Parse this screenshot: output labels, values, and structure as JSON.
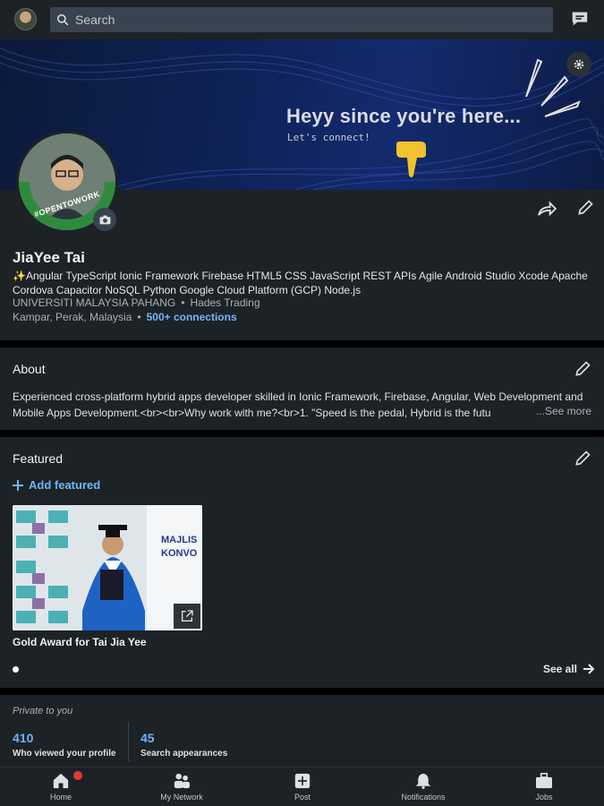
{
  "topbar": {
    "search_placeholder": "Search"
  },
  "banner": {
    "title": "Heyy since you're here...",
    "subtitle": "Let's connect!"
  },
  "profile": {
    "badge_text": "#OPENTOWORK",
    "name": "JiaYee Tai",
    "headline": "✨Angular TypeScript Ionic Framework Firebase HTML5 CSS JavaScript REST APIs Agile Android Studio Xcode Apache Cordova Capacitor NoSQL Python Google Cloud Platform (GCP) Node.js",
    "education": "UNIVERSITI MALAYSIA PAHANG",
    "company": "Hades Trading",
    "location": "Kampar, Perak, Malaysia",
    "connections": "500+ connections",
    "separator": "•"
  },
  "about": {
    "title": "About",
    "text": "Experienced cross-platform hybrid apps developer skilled in Ionic Framework, Firebase, Angular, Web Development and Mobile Apps Development.<br><br>Why work with me?<br>1. \"Speed is the pedal, Hybrid is the futu",
    "see_more": "...See more"
  },
  "featured": {
    "title": "Featured",
    "add_label": "Add featured",
    "item_caption": "Gold Award for Tai Jia Yee",
    "image_sign_text": "MAJLIS KONVO",
    "see_all": "See all"
  },
  "private": {
    "title": "Private to you",
    "stats": [
      {
        "num": "410",
        "label": "Who viewed your profile"
      },
      {
        "num": "45",
        "label": "Search appearances"
      }
    ]
  },
  "nav": {
    "items": [
      {
        "label": "Home"
      },
      {
        "label": "My Network"
      },
      {
        "label": "Post"
      },
      {
        "label": "Notifications"
      },
      {
        "label": "Jobs"
      }
    ]
  },
  "colors": {
    "accent": "#70b5f9",
    "card": "#1d2226",
    "badge": "#e03a3a",
    "opentowork": "#2e8b3e"
  }
}
